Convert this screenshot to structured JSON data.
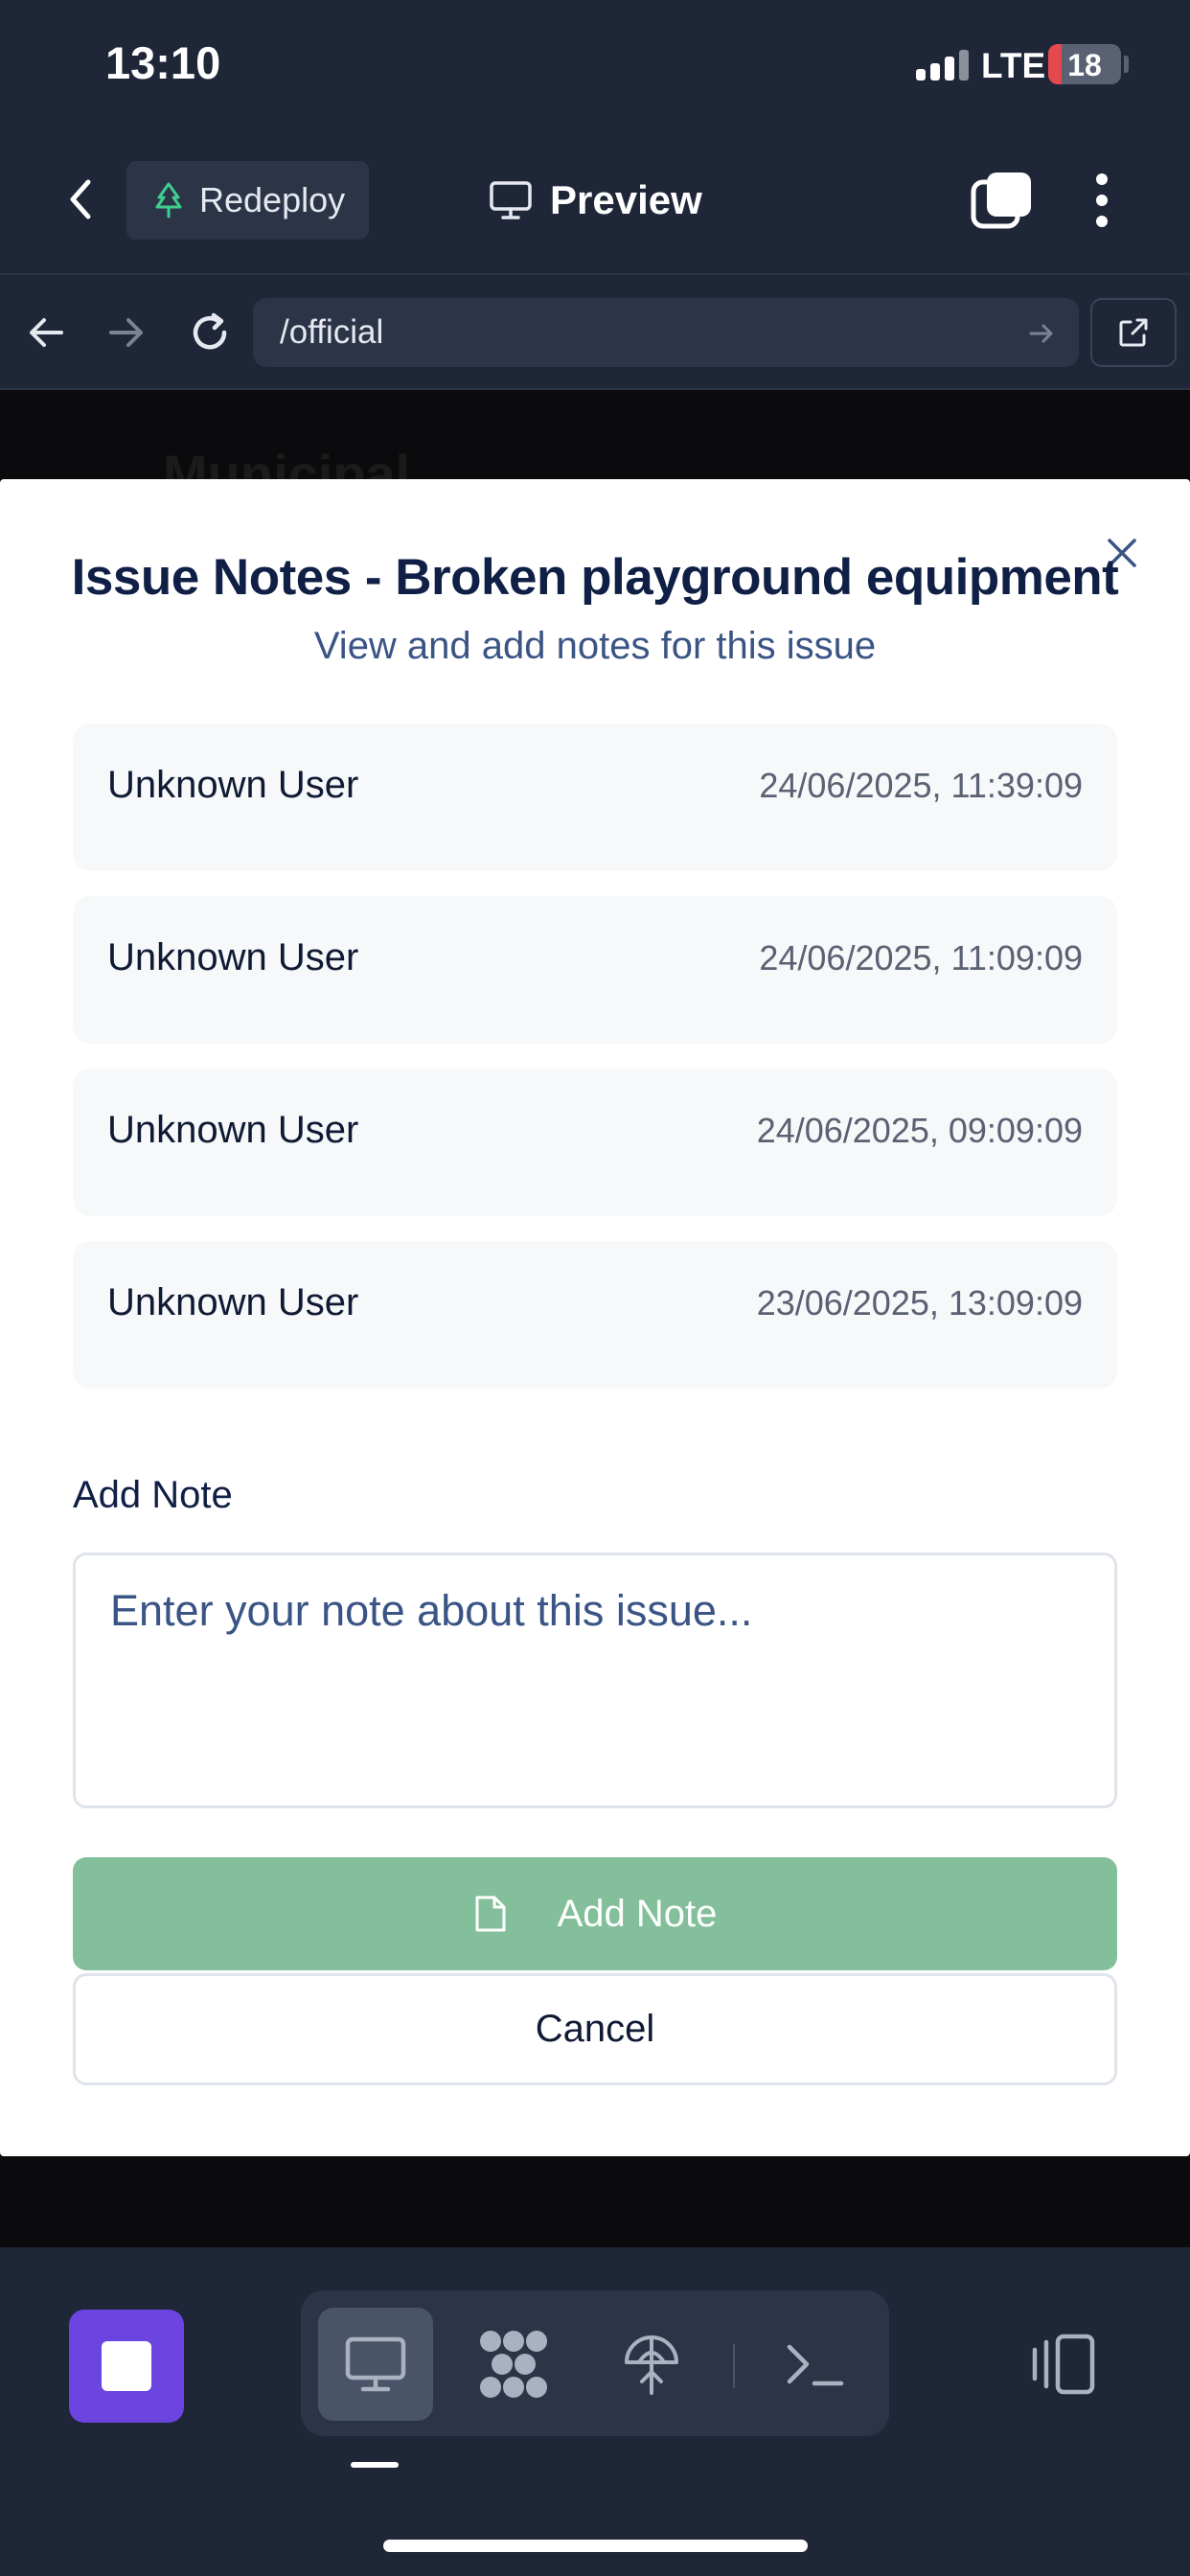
{
  "status_bar": {
    "time": "13:10",
    "network": "LTE",
    "battery": "18",
    "battery_level": 0.18
  },
  "header": {
    "redeploy_label": "Redeploy",
    "preview_label": "Preview"
  },
  "browser": {
    "url": "/official"
  },
  "background_page": {
    "heading": "Municipal"
  },
  "modal": {
    "title": "Issue Notes - Broken playground equipment",
    "subtitle": "View and add notes for this issue",
    "notes": [
      {
        "author": "Unknown User",
        "timestamp": "24/06/2025, 11:39:09"
      },
      {
        "author": "Unknown User",
        "timestamp": "24/06/2025, 11:09:09"
      },
      {
        "author": "Unknown User",
        "timestamp": "24/06/2025, 09:09:09"
      },
      {
        "author": "Unknown User",
        "timestamp": "23/06/2025, 13:09:09"
      }
    ],
    "add_note_label": "Add Note",
    "note_placeholder": "Enter your note about this issue...",
    "note_value": "",
    "add_note_button": "Add Note",
    "cancel_button": "Cancel"
  },
  "colors": {
    "accent": "#6c44e0",
    "add_button": "#82bf9a",
    "title": "#0f1f45"
  },
  "icons": {
    "header": [
      "back-chevron-icon",
      "tree-icon",
      "monitor-icon",
      "tabs-icon",
      "more-vertical-icon"
    ],
    "browser": [
      "arrow-left-icon",
      "arrow-right-icon",
      "reload-icon",
      "url-go-icon",
      "external-link-icon"
    ],
    "bottom": [
      "stop-icon",
      "monitor-icon",
      "workflow-icon",
      "deploy-icon",
      "terminal-icon",
      "split-view-icon"
    ]
  }
}
